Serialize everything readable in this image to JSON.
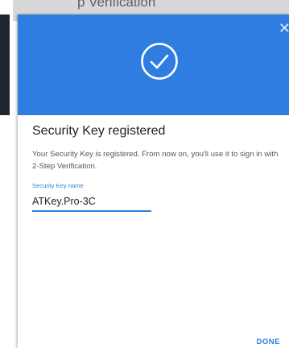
{
  "background": {
    "title_partial": "p Verification"
  },
  "dialog": {
    "close_icon": "close-icon",
    "header_icon": "check-circle-icon",
    "title": "Security Key registered",
    "body": "Your Security Key is registered. From now on, you'll use it to sign in with 2-Step Verification.",
    "field": {
      "label": "Security Key name",
      "value": "ATKey.Pro-3C"
    },
    "done_label": "DONE"
  },
  "colors": {
    "accent": "#2f7de0",
    "header_bg": "#2f7de0"
  }
}
